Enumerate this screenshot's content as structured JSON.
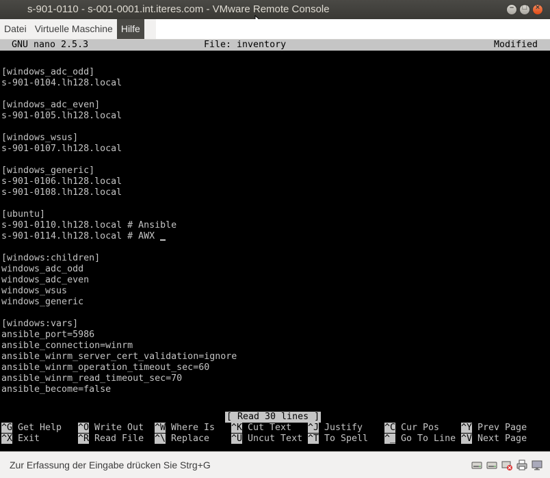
{
  "window": {
    "title": "s-901-0110 - s-001-0001.int.iteres.com - VMware Remote Console",
    "minimize_label": "–",
    "maximize_label": "□",
    "close_label": "×"
  },
  "menu": {
    "items": [
      "Datei",
      "Virtuelle Maschine",
      "Hilfe"
    ]
  },
  "nano": {
    "version": "GNU nano 2.5.3",
    "file": "File: inventory",
    "state": "Modified",
    "lines": [
      "",
      "[windows_adc_odd]",
      "s-901-0104.lh128.local",
      "",
      "[windows_adc_even]",
      "s-901-0105.lh128.local",
      "",
      "[windows_wsus]",
      "s-901-0107.lh128.local",
      "",
      "[windows_generic]",
      "s-901-0106.lh128.local",
      "s-901-0108.lh128.local",
      "",
      "[ubuntu]",
      "s-901-0110.lh128.local # Ansible",
      "s-901-0114.lh128.local # AWX ",
      "",
      "[windows:children]",
      "windows_adc_odd",
      "windows_adc_even",
      "windows_wsus",
      "windows_generic",
      "",
      "[windows:vars]",
      "ansible_port=5986",
      "ansible_connection=winrm",
      "ansible_winrm_server_cert_validation=ignore",
      "ansible_winrm_operation_timeout_sec=60",
      "ansible_winrm_read_timeout_sec=70",
      "ansible_become=false"
    ],
    "status_message": "[ Read 30 lines ]",
    "shortcuts_row1": [
      {
        "key": "^G",
        "label": "Get Help"
      },
      {
        "key": "^O",
        "label": "Write Out"
      },
      {
        "key": "^W",
        "label": "Where Is"
      },
      {
        "key": "^K",
        "label": "Cut Text"
      },
      {
        "key": "^J",
        "label": "Justify"
      },
      {
        "key": "^C",
        "label": "Cur Pos"
      },
      {
        "key": "^Y",
        "label": "Prev Page"
      }
    ],
    "shortcuts_row2": [
      {
        "key": "^X",
        "label": "Exit"
      },
      {
        "key": "^R",
        "label": "Read File"
      },
      {
        "key": "^\\",
        "label": "Replace"
      },
      {
        "key": "^U",
        "label": "Uncut Text"
      },
      {
        "key": "^T",
        "label": "To Spell"
      },
      {
        "key": "^_",
        "label": "Go To Line"
      },
      {
        "key": "^V",
        "label": "Next Page"
      }
    ]
  },
  "statusbar": {
    "hint": "Zur Erfassung der Eingabe drücken Sie Strg+G",
    "icons": [
      "hard-disk-icon",
      "hard-disk-icon",
      "network-disconnected-icon",
      "printer-icon",
      "monitor-icon"
    ]
  }
}
